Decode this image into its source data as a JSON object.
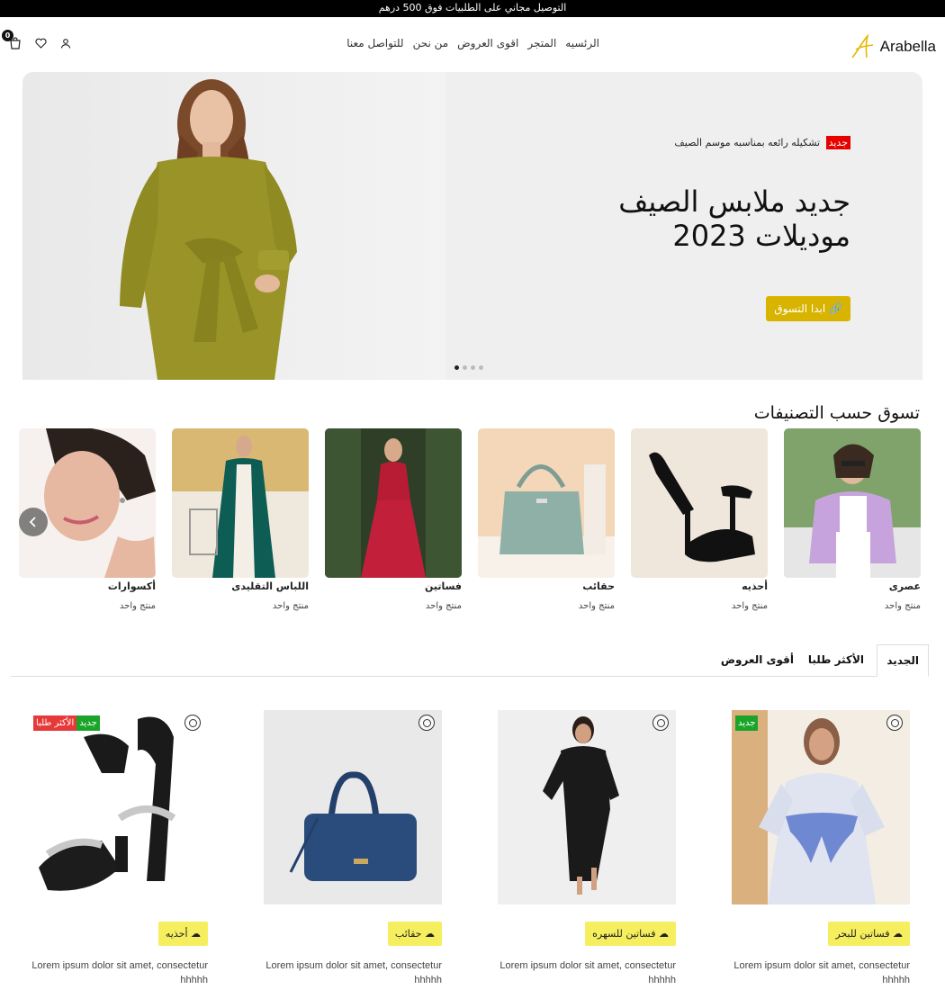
{
  "announcement": "التوصيل مجاني على الطلبيات فوق 500 درهم",
  "brand": {
    "name": "Arabella",
    "accent": "#e6b800"
  },
  "nav": [
    "الرئسيه",
    "المتجر",
    "اقوى العروض",
    "من نحن",
    "للتواصل معنا"
  ],
  "header_icons": {
    "cart_count": "0",
    "icons": [
      "user-icon",
      "heart-icon",
      "cart-icon"
    ]
  },
  "hero": {
    "tag": "جديد",
    "kicker": "تشكيله رائعه بمناسبه موسم الصيف",
    "title_line1": "جديد ملابس الصيف",
    "title_line2": "موديلات 2023",
    "button": "ابدا التسوق",
    "slides": 4,
    "active_slide": 1
  },
  "categories": {
    "heading": "تسوق حسب التصنيفات",
    "items": [
      {
        "name": "عصرى",
        "count": "منتج واحد"
      },
      {
        "name": "أحذيه",
        "count": "منتج واحد"
      },
      {
        "name": "حقائب",
        "count": "منتج واحد"
      },
      {
        "name": "فساتين",
        "count": "منتج واحد"
      },
      {
        "name": "اللباس التقليدى",
        "count": "منتج واحد"
      },
      {
        "name": "أكسوارات",
        "count": "منتج واحد"
      }
    ]
  },
  "tabs": {
    "new": "الجديد",
    "most_wanted": "الأكثر طلبا",
    "best_offers": "أقوى العروض"
  },
  "products": [
    {
      "category": "فساتين للبحر",
      "desc": "Lorem ipsum dolor sit amet, consectetur hhhhh",
      "badges": [
        "جديد"
      ]
    },
    {
      "category": "فساتين للسهره",
      "desc": "Lorem ipsum dolor sit amet, consectetur hhhhh",
      "badges": []
    },
    {
      "category": "حقائب",
      "desc": "Lorem ipsum dolor sit amet, consectetur hhhhh",
      "badges": []
    },
    {
      "category": "أحذيه",
      "desc": "Lorem ipsum dolor sit amet, consectetur hhhhh",
      "badges": [
        "جديد",
        "الأكثر طلبا"
      ]
    }
  ]
}
